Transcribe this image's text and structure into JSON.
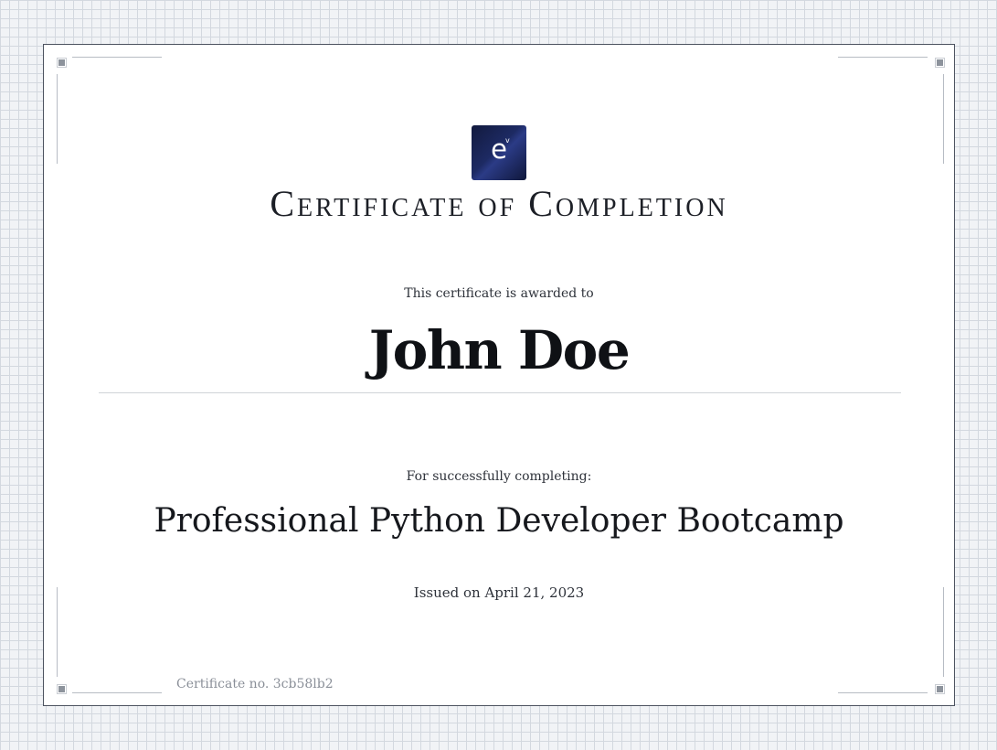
{
  "logo": {
    "letter": "e",
    "superscript": "v",
    "colors": [
      "#121a3e",
      "#2b3b86"
    ]
  },
  "certificate": {
    "title": "Certificate of Completion",
    "awarded_label": "This certificate is awarded to",
    "recipient_name": "John Doe",
    "completion_label": "For successfully completing:",
    "course_name": "Professional Python Developer Bootcamp",
    "issued_text": "Issued on April 21, 2023",
    "certificate_number": "Certificate no. 3cb58lb2"
  },
  "colors": {
    "frame_border": "#4d5360",
    "background_grid": "#d3d8df",
    "ornament": "#8d939c"
  }
}
